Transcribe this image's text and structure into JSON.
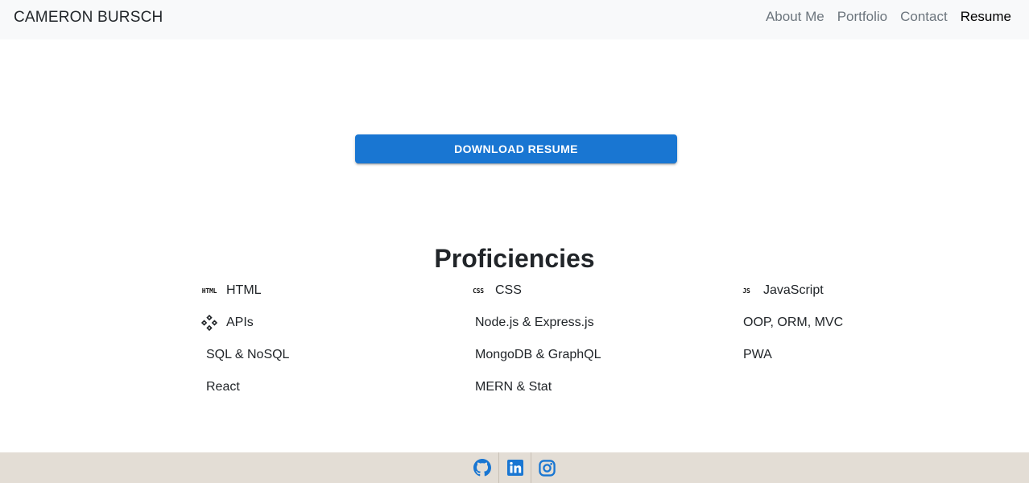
{
  "nav": {
    "brand": "CAMERON BURSCH",
    "links": [
      {
        "label": "About Me",
        "active": false
      },
      {
        "label": "Portfolio",
        "active": false
      },
      {
        "label": "Contact",
        "active": false
      },
      {
        "label": "Resume",
        "active": true
      }
    ]
  },
  "resume": {
    "download_label": "DOWNLOAD RESUME"
  },
  "proficiencies": {
    "title": "Proficiencies",
    "items": [
      {
        "label": "HTML",
        "icon": "html-icon",
        "badge": "HTML"
      },
      {
        "label": "CSS",
        "icon": "css-icon",
        "badge": "CSS"
      },
      {
        "label": "JavaScript",
        "icon": "javascript-icon",
        "badge": "JS"
      },
      {
        "label": "APIs",
        "icon": "api-icon"
      },
      {
        "label": "Node.js & Express.js"
      },
      {
        "label": "OOP, ORM, MVC"
      },
      {
        "label": "SQL & NoSQL"
      },
      {
        "label": "MongoDB & GraphQL"
      },
      {
        "label": "PWA"
      },
      {
        "label": "React"
      },
      {
        "label": "MERN & Stat"
      }
    ]
  },
  "footer": {
    "links": [
      {
        "icon": "github-icon"
      },
      {
        "icon": "linkedin-icon"
      },
      {
        "icon": "instagram-icon"
      }
    ]
  },
  "colors": {
    "primary": "#1976d2",
    "navbar_bg": "#f8f9fa",
    "footer_bg": "#e3ddd5",
    "nav_link": "#6c757d",
    "nav_active": "#000000"
  }
}
